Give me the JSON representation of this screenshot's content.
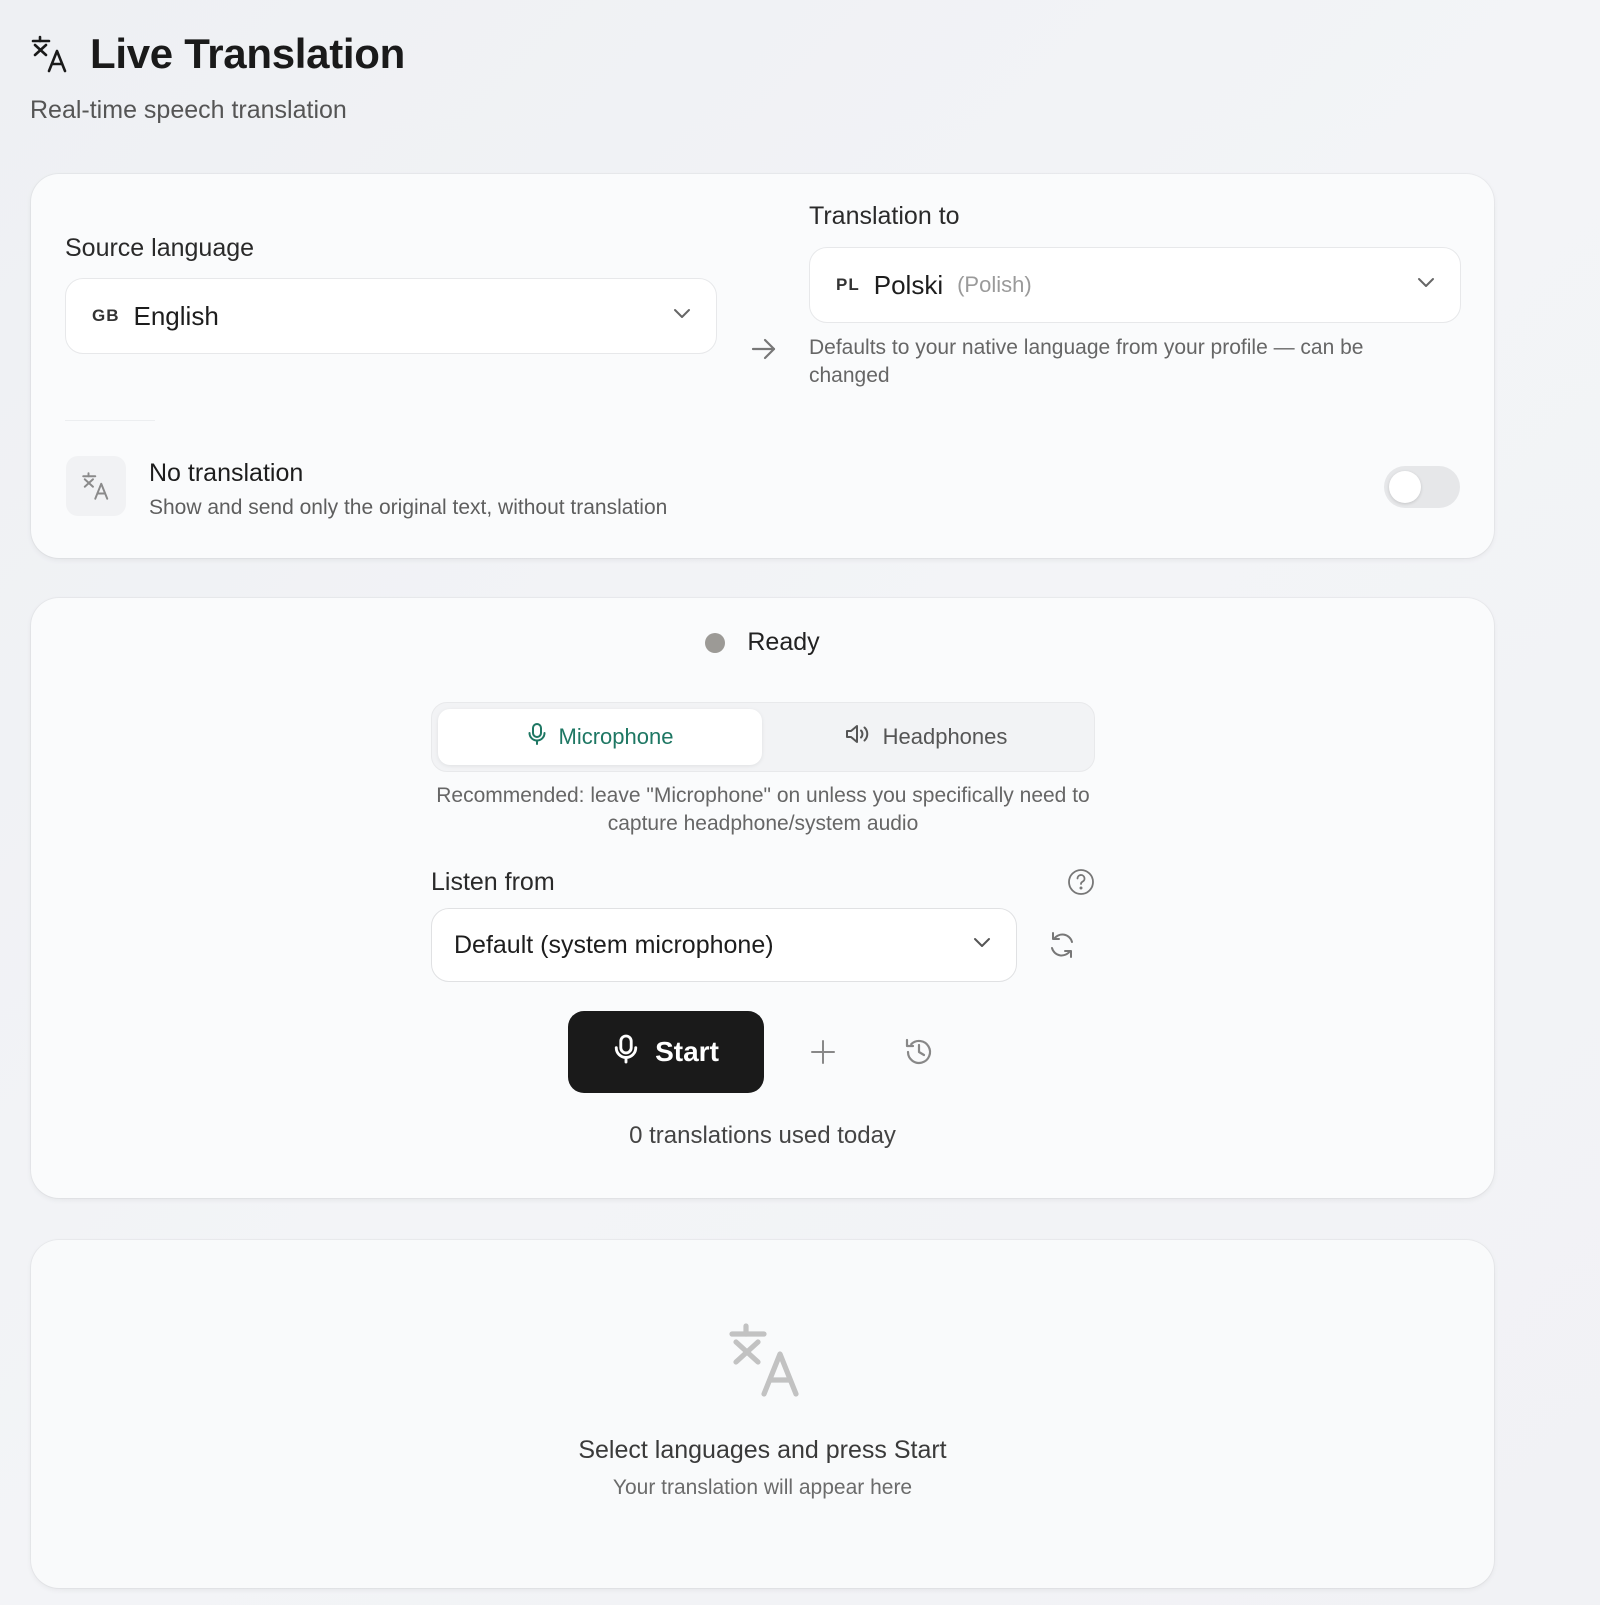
{
  "header": {
    "title": "Live Translation",
    "subtitle": "Real-time speech translation"
  },
  "languages": {
    "source_label": "Source language",
    "source": {
      "code": "GB",
      "name": "English"
    },
    "target_label": "Translation to",
    "target": {
      "code": "PL",
      "name": "Polski",
      "native": "(Polish)"
    },
    "target_hint": "Defaults to your native language from your profile — can be changed"
  },
  "no_translation": {
    "title": "No translation",
    "description": "Show and send only the original text, without translation",
    "enabled": false
  },
  "session": {
    "status": "Ready",
    "status_color": "#9c9a96",
    "modes": [
      {
        "label": "Microphone",
        "icon": "microphone-icon",
        "active": true
      },
      {
        "label": "Headphones",
        "icon": "speaker-icon",
        "active": false
      }
    ],
    "recommendation": "Recommended: leave \"Microphone\" on unless you specifically need to capture headphone/system audio",
    "listen_from_label": "Listen from",
    "device": "Default (system microphone)",
    "start_label": "Start",
    "usage": "0 translations used today"
  },
  "output": {
    "empty_title": "Select languages and press Start",
    "empty_subtitle": "Your translation will appear here"
  },
  "colors": {
    "accent": "#1e7763",
    "primary_button": "#1a1a1a"
  }
}
